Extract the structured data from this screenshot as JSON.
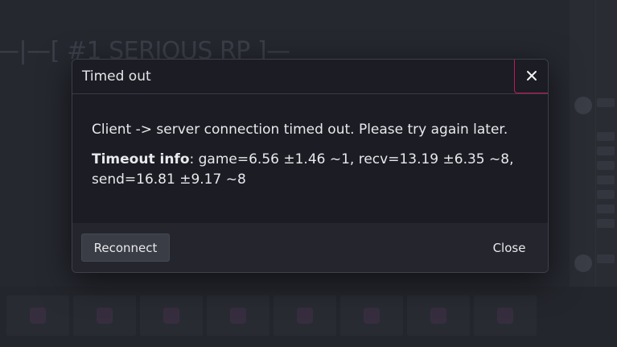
{
  "background": {
    "server_title": "—|—[ #1 SERIOUS RP ]—"
  },
  "dialog": {
    "title": "Timed out",
    "message": "Client -> server connection timed out. Please try again later.",
    "info_label": "Timeout info",
    "info_text": ": game=6.56 ±1.46 ~1, recv=13.19 ±6.35 ~8, send=16.81 ±9.17 ~8",
    "reconnect_label": "Reconnect",
    "close_label": "Close"
  },
  "colors": {
    "accent": "#c2185b",
    "modal_bg": "#1b1c24",
    "footer_bg": "#24252d"
  },
  "icons": {
    "close": "close-icon"
  }
}
